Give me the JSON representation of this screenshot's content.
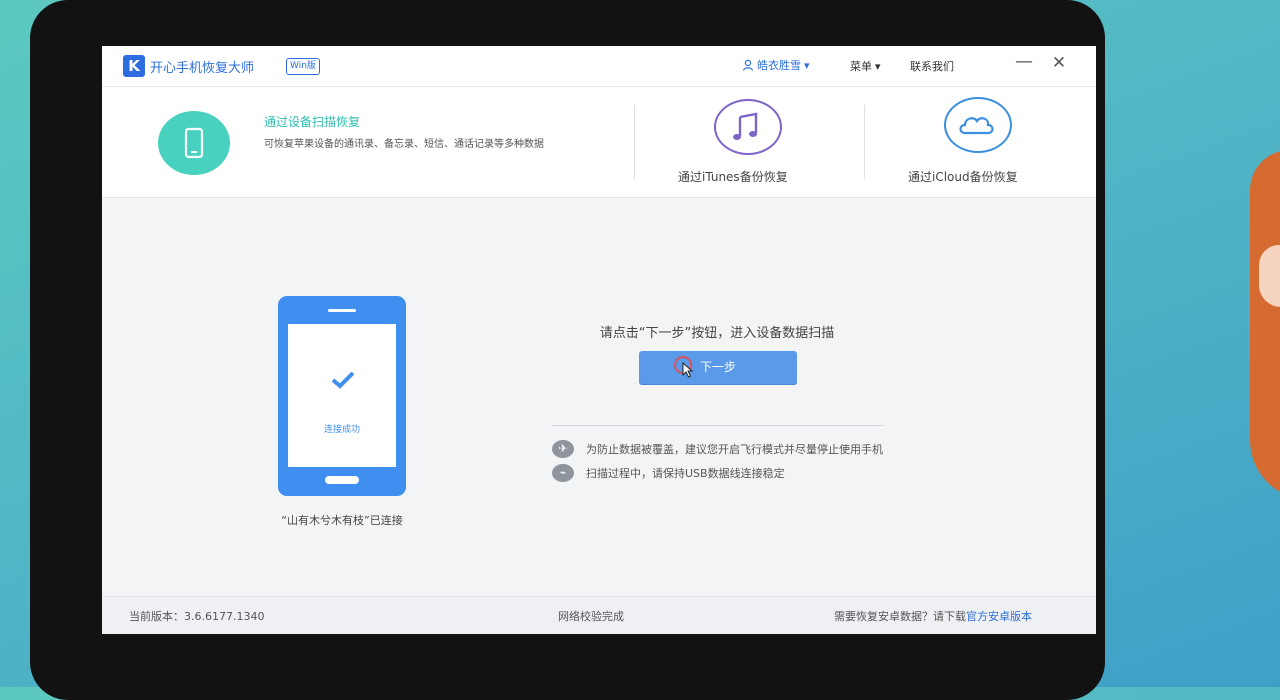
{
  "app": {
    "logo_letter": "K",
    "title": "开心手机恢复大师",
    "badge": "Win版"
  },
  "titlebar": {
    "user_name": "皓衣胜雪",
    "user_caret": "▾",
    "menu_label": "菜单",
    "menu_caret": "▾",
    "contact_label": "联系我们",
    "minimize": "—",
    "close": "✕"
  },
  "modes": {
    "device_scan": {
      "title": "通过设备扫描恢复",
      "desc": "可恢复苹果设备的通讯录、备忘录、短信、通话记录等多种数据"
    },
    "itunes": {
      "label": "通过iTunes备份恢复",
      "icon": "music-note-icon"
    },
    "icloud": {
      "label": "通过iCloud备份恢复",
      "icon": "cloud-icon"
    }
  },
  "main": {
    "connected_text": "连接成功",
    "device_status": "“山有木兮木有枝”已连接",
    "instruction": "请点击“下一步”按钮，进入设备数据扫描",
    "next_button": "下一步",
    "tips": [
      {
        "icon": "✈",
        "text": "为防止数据被覆盖，建议您开启飞行模式并尽量停止使用手机"
      },
      {
        "icon": "⌁",
        "text": "扫描过程中，请保持USB数据线连接稳定"
      }
    ]
  },
  "footer": {
    "version": "当前版本：3.6.6177.1340",
    "network": "网络校验完成",
    "need_android": "需要恢复安卓数据？请下载",
    "android_link": "官方安卓版本"
  },
  "colors": {
    "accent": "#2c6fd9",
    "teal": "#49d1bf",
    "button": "#5a9ae8",
    "itunes_ring": "#7e64c8",
    "icloud_ring": "#3b8fe0"
  }
}
